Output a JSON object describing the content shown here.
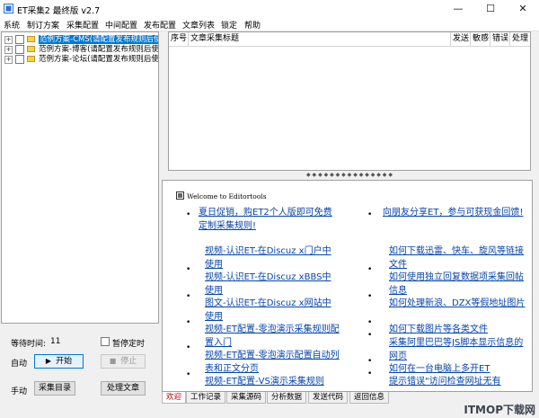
{
  "window": {
    "title": "ET采集2 最终版 v2.7",
    "minimize": "—",
    "maximize": "☐",
    "close": "✕"
  },
  "menu": [
    "系统",
    "制订方案",
    "采集配置",
    "中间配置",
    "发布配置",
    "文章列表",
    "锁定",
    "帮助"
  ],
  "tree": [
    {
      "label": "范例方案-CMS(请配置发布规则后使",
      "selected": true
    },
    {
      "label": "范例方案-博客(请配置发布规则后使",
      "selected": false
    },
    {
      "label": "范例方案-论坛(请配置发布规则后使",
      "selected": false
    }
  ],
  "controls": {
    "wait_label": "等待时间:",
    "wait_value": "11",
    "pause_label": "暂停定时",
    "auto_label": "自动",
    "start_button": "开始",
    "stop_button": "停止",
    "manual_label": "手动",
    "collect_catalog_button": "采集目录",
    "process_article_button": "处理文章"
  },
  "grid": {
    "columns": [
      "序号",
      "文章采集标题",
      "发送",
      "敏感",
      "错误",
      "处理"
    ]
  },
  "browser": {
    "welcome": "Welcome to Editortools",
    "left_links": [
      "夏日促销，购ET2个人版即可免费定制采集规则!",
      "视频-认识ET-在Discuz x门户中使用",
      "视频-认识ET-在Discuz xBBS中使用",
      "图文-认识ET-在Discuz x网站中使用",
      "视频-ET配置-零泡演示采集规则配置入门",
      "视频-ET配置-零泡演示配置自动列表和正文分页",
      "视频-ET配置-VS演示采集规则"
    ],
    "right_links": [
      "向朋友分享ET，参与可获现金回馈!",
      "如何下载迅雷、快车、旋风等链接文件",
      "如何使用独立回复数据项采集回帖信息",
      "如何处理新浪、DZX等假地址图片",
      "如何下载图片等各类文件",
      "采集阿里巴巴等JS脚本显示信息的网页",
      "如何在一台电脑上多开ET",
      "提示错误\"访问检查网址无有"
    ]
  },
  "tabs": [
    "欢迎",
    "工作记录",
    "采集源码",
    "分析数据",
    "发送代码",
    "返回信息"
  ],
  "watermark": "ITMOP下载网",
  "colors": {
    "selection": "#0078d7",
    "link": "#0645ad",
    "active_tab_text": "#c00000"
  }
}
